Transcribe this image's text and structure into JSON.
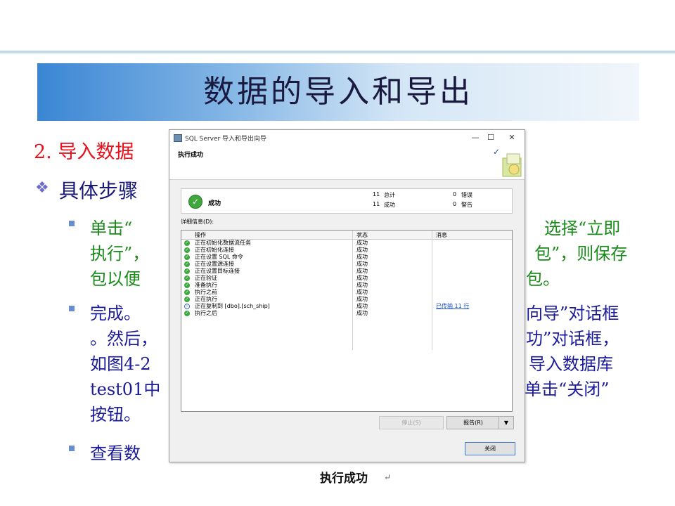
{
  "slide": {
    "title": "数据的导入和导出",
    "heading": "2. 导入数据",
    "subheading": "具体步骤",
    "bullet1_line1_left": "单击“",
    "bullet1_line1_right": "选择“立即",
    "bullet1_line2_left": "执行”，",
    "bullet1_line2_right": "包”，则保存",
    "bullet1_line3_left": "包以便",
    "bullet1_line3_right": "包。",
    "bullet2_line1_left": "完成。",
    "bullet2_line1_right": "向导”对话框",
    "bullet2_line2_left": "。然后，",
    "bullet2_line2_right": "功”对话框，",
    "bullet2_line3_left": "如图4-2",
    "bullet2_line3_right": "导入数据库",
    "bullet2_line4_left": "test01中",
    "bullet2_line4_right": "单击“关闭”",
    "bullet2_line5_left": "按钮。",
    "bullet3_left": "查看数",
    "caption": "执行成功",
    "caption_mark": "↵"
  },
  "dialog": {
    "window_title": "SQL Server 导入和导出向导",
    "minimize": "—",
    "maximize": "☐",
    "close": "✕",
    "header_title": "执行成功",
    "status_label": "成功",
    "stats": {
      "total_count": "11",
      "total_label": "总计",
      "success_count": "11",
      "success_label": "成功",
      "error_count": "0",
      "error_label": "错误",
      "warning_count": "0",
      "warning_label": "警告"
    },
    "details_label": "详细信息(D):",
    "columns": [
      "操作",
      "状态",
      "消息"
    ],
    "rows": [
      {
        "op": "正在初始化数据流任务",
        "status": "成功",
        "msg": "",
        "icon": "success-icon"
      },
      {
        "op": "正在初始化连接",
        "status": "成功",
        "msg": "",
        "icon": "success-icon"
      },
      {
        "op": "正在设置 SQL 命令",
        "status": "成功",
        "msg": "",
        "icon": "success-icon"
      },
      {
        "op": "正在设置源连接",
        "status": "成功",
        "msg": "",
        "icon": "success-icon"
      },
      {
        "op": "正在设置目标连接",
        "status": "成功",
        "msg": "",
        "icon": "success-icon"
      },
      {
        "op": "正在验证",
        "status": "成功",
        "msg": "",
        "icon": "success-icon"
      },
      {
        "op": "准备执行",
        "status": "成功",
        "msg": "",
        "icon": "success-icon"
      },
      {
        "op": "执行之前",
        "status": "成功",
        "msg": "",
        "icon": "success-icon"
      },
      {
        "op": "正在执行",
        "status": "成功",
        "msg": "",
        "icon": "success-icon"
      },
      {
        "op": "正在复制到 [dbo].[sch_ship]",
        "status": "成功",
        "msg": "已传输 11 行",
        "icon": "info-icon"
      },
      {
        "op": "执行之后",
        "status": "成功",
        "msg": "",
        "icon": "success-icon"
      }
    ],
    "stop_button": "停止(S)",
    "report_button": "报告(R)",
    "report_arrow": "▼",
    "close_button": "关闭",
    "colors": {
      "success": "#3ea83e",
      "link": "#1a50c0"
    }
  }
}
